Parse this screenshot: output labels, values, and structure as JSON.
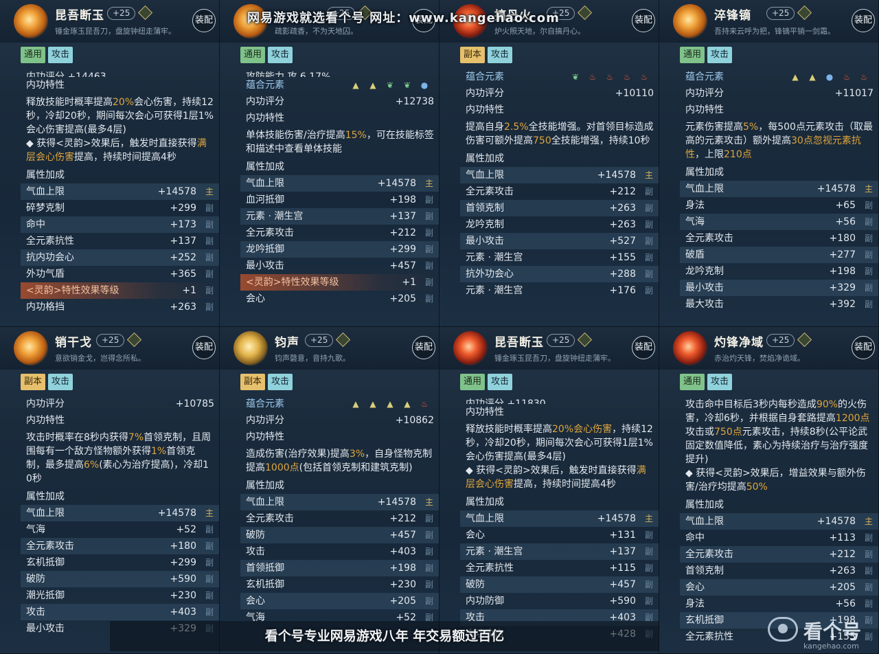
{
  "watermark_top": "网易游戏就选看个号   网址：www.kangehao.com",
  "watermark_bottom": "看个号专业网易游戏八年   年交易额过百亿",
  "logo": {
    "text": "看个号",
    "url": "kangehao.com"
  },
  "equip_label": "装配",
  "level_badge": "+25",
  "section_attrs": "属性加成",
  "panels": [
    {
      "name": "昆吾断玉",
      "desc": "锤金琢玉昆吾刀，盘旋钟纽走蒲牢。",
      "icon": "blade-gold-icon",
      "tags": [
        {
          "t": "通用",
          "c": "green"
        },
        {
          "t": "攻击",
          "c": "blue"
        }
      ],
      "top_cut": "内功评分      +14463",
      "rows_top": [
        {
          "l": "内功特性"
        }
      ],
      "para": "释放技能时概率提高<span class=hi>20%</span>会心伤害，持续12秒，冷却20秒，期间每次会心可获得1层1%会心伤害提高(最多4层)<br>◆ 获得&lt;灵韵&gt;效果后，触发时直接获得<span class=hi>满层会心伤害</span>提高，持续时间提高4秒",
      "attrs": [
        [
          "气血上限",
          "+14578",
          "主"
        ],
        [
          "碎梦克制",
          "+299",
          "副"
        ],
        [
          "命中",
          "+173",
          "副"
        ],
        [
          "全元素抗性",
          "+137",
          "副"
        ],
        [
          "抗内功会心",
          "+252",
          "副"
        ],
        [
          "外功气盾",
          "+365",
          "副"
        ],
        [
          "<灵韵>特性效果等级",
          "+1",
          "副",
          "hl"
        ],
        [
          "内功格挡",
          "+263",
          "副"
        ]
      ]
    },
    {
      "name": "",
      "desc": "疏影疏香，不为天地囚。",
      "icon": "blade-gold-icon",
      "tags": [
        {
          "t": "通用",
          "c": "green"
        },
        {
          "t": "攻击",
          "c": "blue"
        }
      ],
      "top_cut": "攻防能力      攻 6.17%",
      "elements": [
        "tri",
        "tri",
        "leaf",
        "leaf",
        "water"
      ],
      "rows_top": [
        {
          "l": "蕴合元素",
          "blue": true
        },
        {
          "l": "内功评分",
          "v": "+12738"
        },
        {
          "l": "内功特性"
        }
      ],
      "para": "单体技能伤害/治疗提高<span class=hi>15%</span>，可在技能标签和描述中查看单体技能",
      "attrs": [
        [
          "气血上限",
          "+14578",
          "主"
        ],
        [
          "血河抵御",
          "+198",
          "副"
        ],
        [
          "元素 · 潮生宫",
          "+137",
          "副"
        ],
        [
          "全元素攻击",
          "+212",
          "副"
        ],
        [
          "龙吟抵御",
          "+299",
          "副"
        ],
        [
          "最小攻击",
          "+457",
          "副"
        ],
        [
          "<灵韵>特性效果等级",
          "+1",
          "副",
          "hl"
        ],
        [
          "会心",
          "+205",
          "副"
        ]
      ]
    },
    {
      "name": "搞丹火",
      "desc": "炉火照天地，尔自搞丹心。",
      "icon": "flame-orb-icon",
      "tags": [
        {
          "t": "副本",
          "c": "gold"
        },
        {
          "t": "攻击",
          "c": "blue"
        }
      ],
      "elements": [
        "leaf",
        "fire",
        "fire",
        "fire",
        "fire"
      ],
      "rows_top": [
        {
          "l": "蕴合元素",
          "blue": true
        },
        {
          "l": "内功评分",
          "v": "+10110"
        },
        {
          "l": "内功特性"
        }
      ],
      "para": "提高自身<span class=hi>2.5%</span>全技能增强。对首领目标造成伤害可额外提高<span class=hi>750</span>全技能增强，持续10秒",
      "attrs": [
        [
          "气血上限",
          "+14578",
          "主"
        ],
        [
          "全元素攻击",
          "+212",
          "副"
        ],
        [
          "首领克制",
          "+263",
          "副"
        ],
        [
          "龙吟克制",
          "+263",
          "副"
        ],
        [
          "最小攻击",
          "+527",
          "副"
        ],
        [
          "元素 · 潮生宫",
          "+155",
          "副"
        ],
        [
          "抗外功会心",
          "+288",
          "副"
        ],
        [
          "元素 · 潮生宫",
          "+176",
          "副"
        ]
      ]
    },
    {
      "name": "淬锋镝",
      "desc": "吾持来云呼为把，锋镝平销一剑霜。",
      "icon": "blade-gold-icon",
      "tags": [
        {
          "t": "通用",
          "c": "green"
        },
        {
          "t": "攻击",
          "c": "blue"
        }
      ],
      "elements": [
        "tri",
        "tri",
        "water",
        "fire",
        "fire"
      ],
      "rows_top": [
        {
          "l": "蕴合元素",
          "blue": true
        },
        {
          "l": "内功评分",
          "v": "+11017"
        },
        {
          "l": "内功特性"
        }
      ],
      "para": "元素伤害提高<span class=hi>5%</span>，每500点元素攻击（取最高的元素攻击）额外提高<span class=hi>30点忽视元素抗性</span>，上限<span class=hi>210点</span>",
      "attrs": [
        [
          "气血上限",
          "+14578",
          "主"
        ],
        [
          "身法",
          "+65",
          "副"
        ],
        [
          "气海",
          "+56",
          "副"
        ],
        [
          "全元素攻击",
          "+180",
          "副"
        ],
        [
          "破盾",
          "+277",
          "副"
        ],
        [
          "龙吟克制",
          "+198",
          "副"
        ],
        [
          "最小攻击",
          "+329",
          "副"
        ],
        [
          "最大攻击",
          "+392",
          "副"
        ]
      ]
    },
    {
      "name": "销干戈",
      "desc": "意欲销金戈，岂得念所私。",
      "icon": "blade-gold-icon",
      "tags": [
        {
          "t": "副本",
          "c": "gold"
        },
        {
          "t": "攻击",
          "c": "blue"
        }
      ],
      "rows_top": [
        {
          "l": "内功评分",
          "v": "+10785"
        },
        {
          "l": "内功特性"
        }
      ],
      "para": "攻击时概率在8秒内获得<span class=hi>7%</span>首领克制，且周围每有一个敌方怪物额外获得<span class=hi>1%</span>首领克制，最多提高<span class=hi>6%</span>(素心为治疗提高)，冷却10秒",
      "attrs": [
        [
          "气血上限",
          "+14578",
          "主"
        ],
        [
          "气海",
          "+52",
          "副"
        ],
        [
          "全元素攻击",
          "+180",
          "副"
        ],
        [
          "玄机抵御",
          "+299",
          "副"
        ],
        [
          "破防",
          "+590",
          "副"
        ],
        [
          "潮光抵御",
          "+230",
          "副"
        ],
        [
          "攻击",
          "+403",
          "副"
        ],
        [
          "最小攻击",
          "+329",
          "副"
        ]
      ]
    },
    {
      "name": "钧声",
      "desc": "钧声磬意，音持九歌。",
      "icon": "gong-icon",
      "tags": [
        {
          "t": "副本",
          "c": "gold"
        },
        {
          "t": "攻击",
          "c": "blue"
        }
      ],
      "elements": [
        "tri",
        "tri",
        "tri",
        "tri",
        "fire"
      ],
      "rows_top": [
        {
          "l": "蕴合元素",
          "blue": true
        },
        {
          "l": "内功评分",
          "v": "+10862"
        },
        {
          "l": "内功特性"
        }
      ],
      "para": "造成伤害(治疗效果)提高<span class=hi>3%</span>，自身怪物克制提高<span class=hi>1000点</span>(包括首领克制和建筑克制)",
      "attrs": [
        [
          "气血上限",
          "+14578",
          "主"
        ],
        [
          "全元素攻击",
          "+212",
          "副"
        ],
        [
          "破防",
          "+457",
          "副"
        ],
        [
          "攻击",
          "+403",
          "副"
        ],
        [
          "首领抵御",
          "+198",
          "副"
        ],
        [
          "玄机抵御",
          "+230",
          "副"
        ],
        [
          "会心",
          "+205",
          "副"
        ],
        [
          "气海",
          "+52",
          "副"
        ]
      ]
    },
    {
      "name": "昆吾断玉",
      "desc": "锤金琢玉昆吾刀，盘旋钟纽走蒲牢。",
      "icon": "blade-red-icon",
      "tags": [
        {
          "t": "通用",
          "c": "green"
        },
        {
          "t": "攻击",
          "c": "blue"
        }
      ],
      "top_cut": "内功评分      +11830",
      "rows_top": [
        {
          "l": "内功特性"
        }
      ],
      "para": "释放技能时概率提高<span class=hi>20%会心伤害</span>，持续12秒，冷却20秒，期间每次会心可获得1层1%会心伤害提高(最多4层)<br>◆ 获得&lt;灵韵&gt;效果后，触发时直接获得<span class=hi>满层会心伤害</span>提高，持续时间提高4秒",
      "attrs": [
        [
          "气血上限",
          "+14578",
          "主"
        ],
        [
          "会心",
          "+131",
          "副"
        ],
        [
          "元素 · 潮生宫",
          "+137",
          "副"
        ],
        [
          "全元素抗性",
          "+115",
          "副"
        ],
        [
          "破防",
          "+457",
          "副"
        ],
        [
          "内功防御",
          "+590",
          "副"
        ],
        [
          "攻击",
          "+403",
          "副"
        ],
        [
          "内功攻击",
          "+428",
          "副"
        ]
      ]
    },
    {
      "name": "灼锋净域",
      "desc": "赤治灼天锋，焚焰净诡域。",
      "icon": "blade-red-icon",
      "tags": [
        {
          "t": "通用",
          "c": "green"
        },
        {
          "t": "攻击",
          "c": "blue"
        }
      ],
      "rows_top": [],
      "para": "攻击命中目标后3秒内每秒造成<span class=hi>90%</span>的火伤害，冷却6秒，并根据自身套路提高<span class=hi>1200点</span>攻击或<span class=hi>750点</span>元素攻击，持续8秒(公平论武固定数值降低，素心为持续治疗与治疗强度提升)<br>◆ 获得&lt;灵韵&gt;效果后，增益效果与额外伤害/治疗均提高<span class=hi>50%</span>",
      "attrs": [
        [
          "气血上限",
          "+14578",
          "主"
        ],
        [
          "命中",
          "+113",
          "副"
        ],
        [
          "全元素攻击",
          "+212",
          "副"
        ],
        [
          "首领克制",
          "+263",
          "副"
        ],
        [
          "会心",
          "+205",
          "副"
        ],
        [
          "身法",
          "+56",
          "副"
        ],
        [
          "玄机抵御",
          "+198",
          "副"
        ],
        [
          "全元素抗性",
          "+155",
          "副"
        ]
      ]
    }
  ]
}
